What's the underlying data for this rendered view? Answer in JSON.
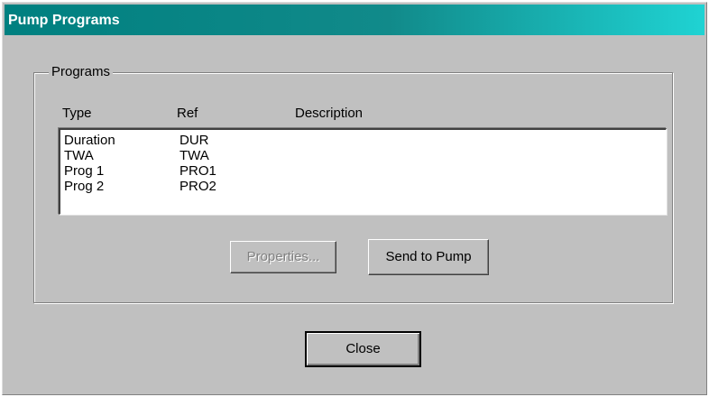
{
  "window": {
    "title": "Pump Programs"
  },
  "programs_group": {
    "label": "Programs",
    "columns": {
      "type": "Type",
      "ref": "Ref",
      "description": "Description"
    },
    "rows": [
      {
        "type": "Duration",
        "ref": "DUR",
        "description": ""
      },
      {
        "type": "TWA",
        "ref": "TWA",
        "description": ""
      },
      {
        "type": "Prog 1",
        "ref": "PRO1",
        "description": ""
      },
      {
        "type": "Prog 2",
        "ref": "PRO2",
        "description": ""
      }
    ],
    "properties_label": "Properties...",
    "send_label": "Send to Pump"
  },
  "footer": {
    "close_label": "Close"
  }
}
